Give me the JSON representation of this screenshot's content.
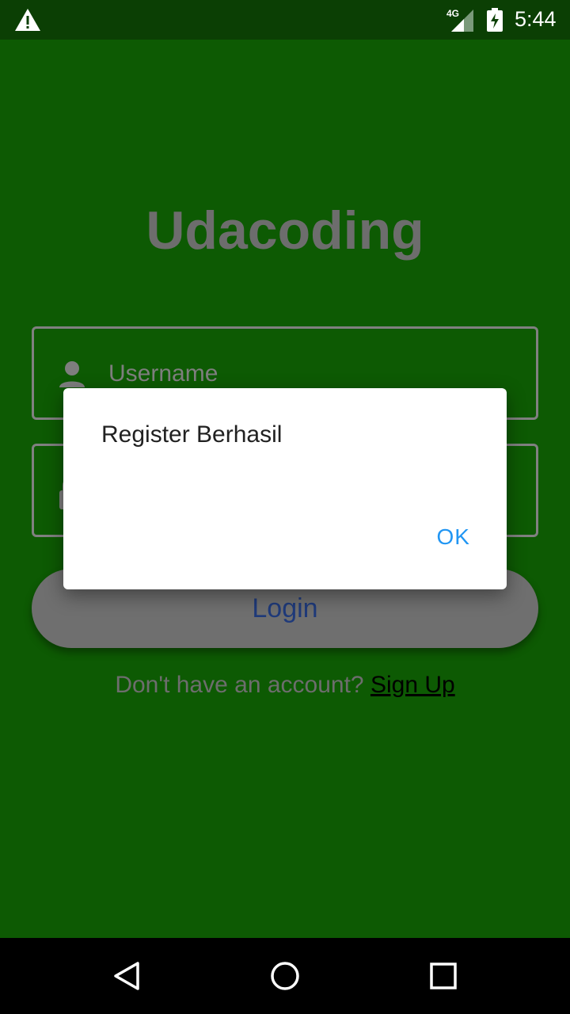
{
  "status_bar": {
    "network_label": "4G",
    "time": "5:44"
  },
  "app": {
    "title": "Udacoding",
    "username_placeholder": "Username",
    "login_label": "Login",
    "signup_prompt": "Don't have an account?",
    "signup_link": "Sign Up"
  },
  "dialog": {
    "message": "Register Berhasil",
    "ok_label": "OK"
  },
  "colors": {
    "background": "#0d5a03",
    "status_bar": "#0b3f04",
    "accent": "#2196f3"
  },
  "icons": [
    "warning-icon",
    "signal-icon",
    "battery-charging-icon",
    "person-icon",
    "lock-icon",
    "back-icon",
    "home-icon",
    "recents-icon"
  ]
}
